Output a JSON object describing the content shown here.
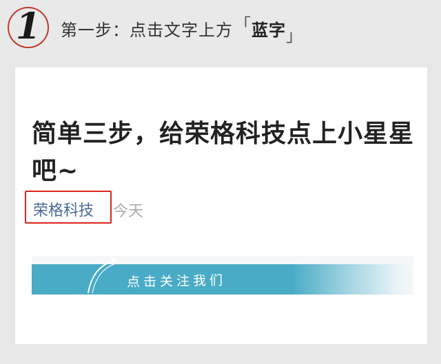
{
  "step": {
    "number": "1",
    "text": "第一步：点击文字上方",
    "highlight": "蓝字",
    "bracket_open": "「",
    "bracket_close": "」"
  },
  "article": {
    "title": "简单三步，给荣格科技点上小星星吧~",
    "account_name": "荣格科技",
    "time": "今天"
  },
  "banner": {
    "text": "点击关注我们",
    "icon": "curved-arrow-icon"
  },
  "colors": {
    "highlight_border": "#d9251d",
    "account_link": "#4a6a94",
    "banner": "#49abc6"
  }
}
